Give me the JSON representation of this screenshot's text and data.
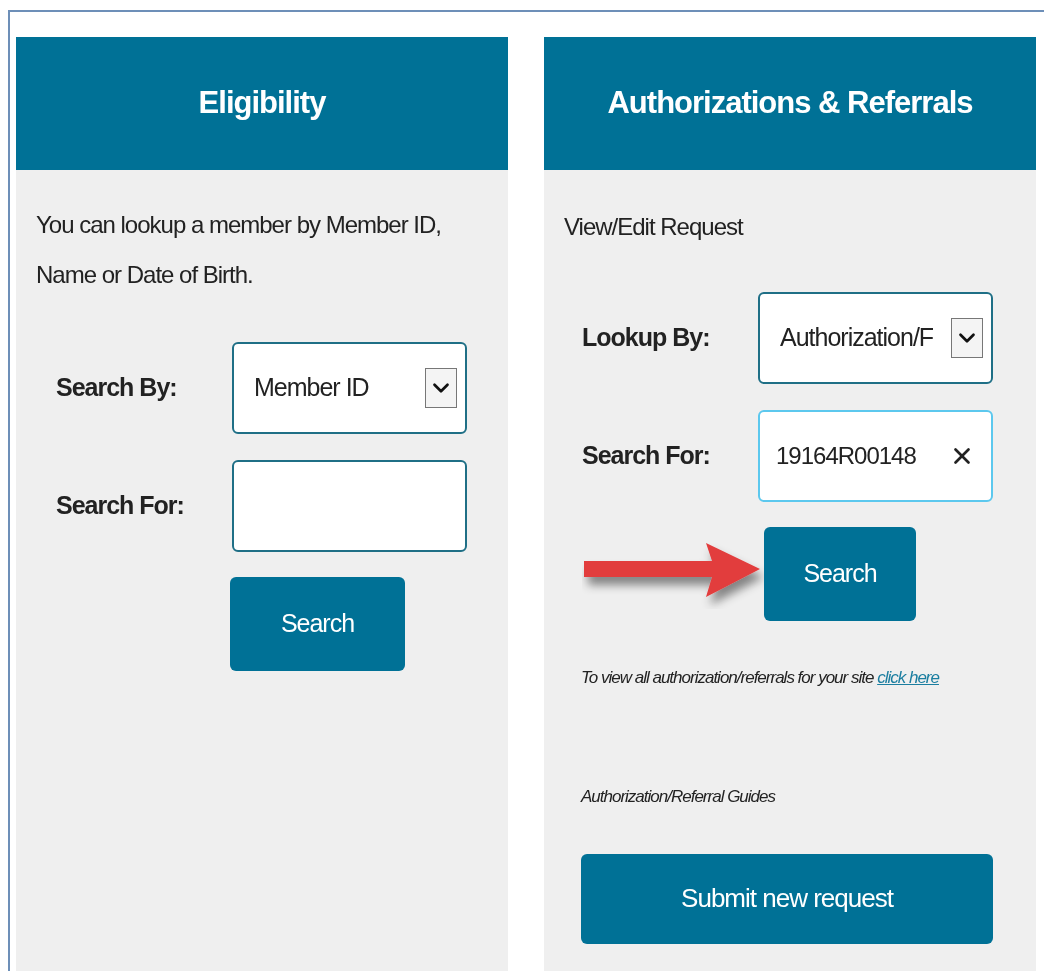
{
  "panels": [
    {
      "kind": "eligibility",
      "title": "Eligibility",
      "intro": "You can lookup a member by Member ID, Name or Date of Birth.",
      "annotated": false,
      "fields": [
        {
          "kind": "select",
          "label": "Search By:",
          "value": "Member ID",
          "focused": false
        },
        {
          "kind": "text",
          "label": "Search For:",
          "focused": false
        }
      ],
      "search_button": "Search"
    },
    {
      "kind": "authorizations",
      "title": "Authorizations & Referrals",
      "intro": "View/Edit Request",
      "annotated": true,
      "fields": [
        {
          "kind": "select",
          "label": "Lookup By:",
          "value": "Authorization/F",
          "focused": false
        },
        {
          "kind": "text",
          "label": "Search For:",
          "value": "19164R00148",
          "focused": true
        }
      ],
      "search_button": "Search",
      "note": "To view all authorization/referrals for your site",
      "note_link": "click here",
      "guides": "Authorization/Referral Guides",
      "submit_button": "Submit new request"
    }
  ]
}
